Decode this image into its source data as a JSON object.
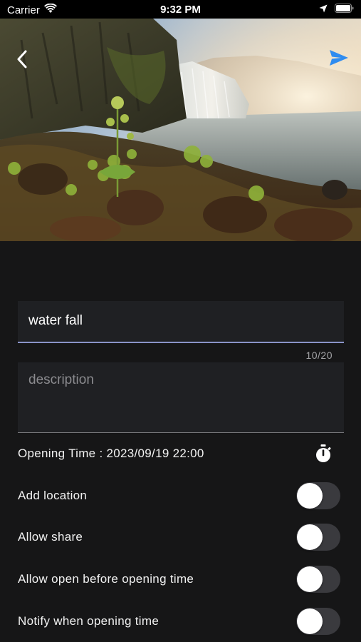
{
  "status_bar": {
    "carrier": "Carrier",
    "time": "9:32 PM"
  },
  "header": {
    "back_icon": "chevron-left-icon",
    "send_icon": "paper-plane-icon",
    "send_color": "#2f8cf0"
  },
  "form": {
    "title_value": "water fall",
    "title_counter": "10/20",
    "description_placeholder": "description",
    "underline_color": "#8a93c8"
  },
  "opening_time": {
    "label": "Opening Time : 2023/09/19 22:00",
    "icon": "stopwatch-icon"
  },
  "toggles": [
    {
      "label": "Add location",
      "on": false
    },
    {
      "label": "Allow share",
      "on": false
    },
    {
      "label": "Allow open before opening time",
      "on": false
    },
    {
      "label": "Notify when opening time",
      "on": false
    }
  ]
}
